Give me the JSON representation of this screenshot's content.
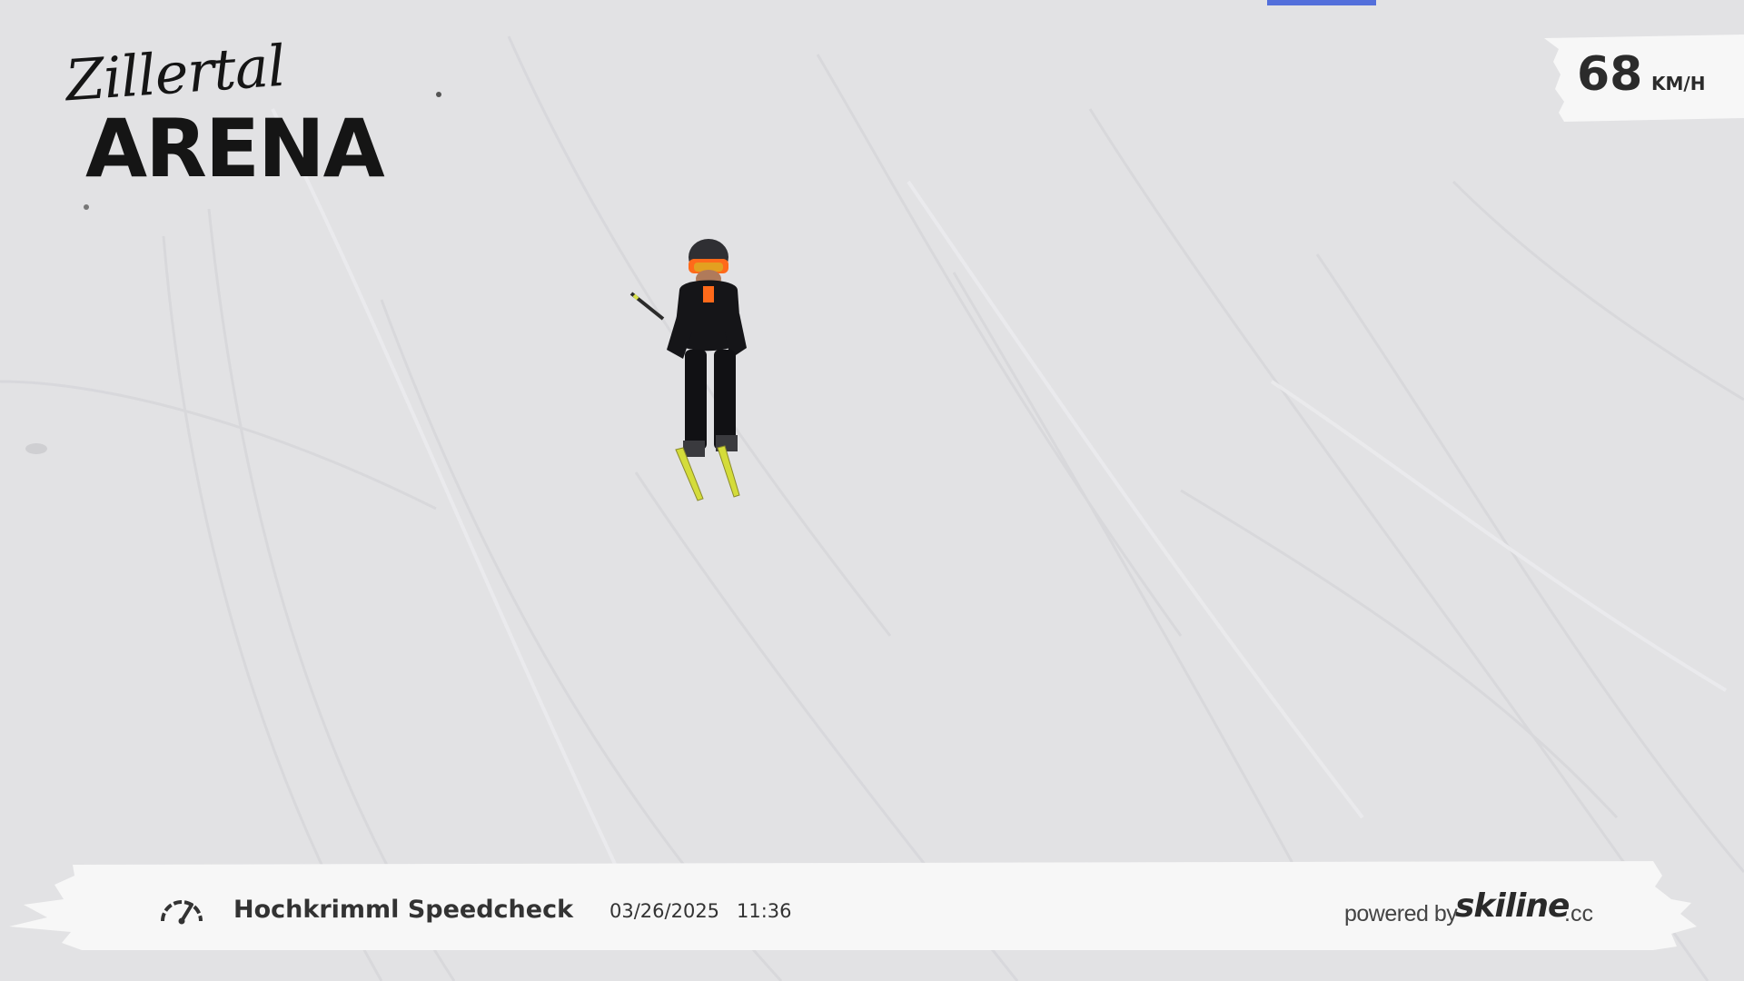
{
  "logo": {
    "script_text": "Zillertal",
    "main_text": "ARENA"
  },
  "speed": {
    "value": "68",
    "unit": "KM/H"
  },
  "footer": {
    "icon": "speedometer-icon",
    "location": "Hochkrimml Speedcheck",
    "date": "03/26/2025",
    "time": "11:36",
    "powered_by": "powered by",
    "brand": "skiline",
    "brand_tld": ".cc"
  },
  "colors": {
    "snow": "#e2e2e4",
    "panel": "#f7f7f7",
    "text": "#333333",
    "accent_orange": "#ff6a1a"
  }
}
